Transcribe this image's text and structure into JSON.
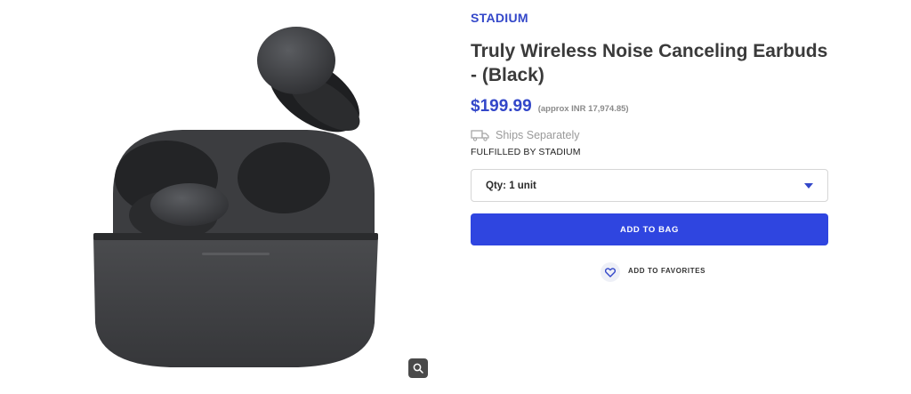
{
  "product": {
    "brand": "STADIUM",
    "title": "Truly Wireless Noise Canceling Earbuds - (Black)",
    "price": "$199.99",
    "approx_price": "(approx INR 17,974.85)",
    "shipping": "Ships Separately",
    "fulfilled": "FULFILLED BY STADIUM"
  },
  "quantity": {
    "selected": "Qty: 1 unit"
  },
  "actions": {
    "add_to_bag": "ADD TO BAG",
    "add_to_favorites": "ADD TO FAVORITES"
  },
  "icons": {
    "shipping": "truck-icon",
    "favorite": "heart-icon",
    "zoom": "magnifier-icon",
    "dropdown": "caret-down-icon"
  },
  "colors": {
    "accent": "#3347c9",
    "button": "#2f45e0"
  }
}
